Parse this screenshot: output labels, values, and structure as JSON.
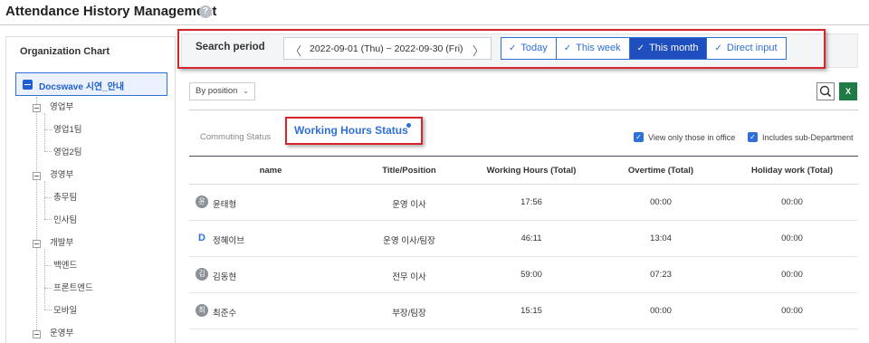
{
  "header": {
    "title": "Attendance History Management",
    "help_glyph": "?"
  },
  "org_chart": {
    "title": "Organization Chart",
    "root_label": "Docswave 시연_안내",
    "groups": [
      {
        "label": "영업부",
        "children": [
          "영업1팀",
          "영업2팀"
        ]
      },
      {
        "label": "경영부",
        "children": [
          "총무팀",
          "인사팀"
        ]
      },
      {
        "label": "개발부",
        "children": [
          "백엔드",
          "프론트엔드",
          "모바일"
        ]
      },
      {
        "label": "운영부",
        "children": []
      }
    ]
  },
  "search": {
    "label": "Search period",
    "prev_glyph": "〈",
    "next_glyph": "〉",
    "range": "2022-09-01 (Thu) ~ 2022-09-30 (Fri)",
    "options": [
      {
        "label": "Today",
        "active": false
      },
      {
        "label": "This week",
        "active": false
      },
      {
        "label": "This month",
        "active": true
      },
      {
        "label": "Direct input",
        "active": false
      }
    ]
  },
  "toolbar": {
    "position_select": "By position",
    "excel_glyph": "X"
  },
  "tabs": {
    "commuting": "Commuting Status",
    "working": "Working Hours Status"
  },
  "filters": {
    "view_in_office": "View only those in office",
    "include_sub": "Includes sub-Department"
  },
  "table": {
    "headers": [
      "name",
      "Title/Position",
      "Working Hours (Total)",
      "Overtime (Total)",
      "Holiday work (Total)"
    ],
    "rows": [
      {
        "avatar": "윤",
        "name": "윤태형",
        "title": "운영 이사",
        "working": "17:56",
        "overtime": "00:00",
        "holiday": "00:00"
      },
      {
        "avatar": "D",
        "name": "정혜이브",
        "title": "운영 이사/팀장",
        "working": "46:11",
        "overtime": "13:04",
        "holiday": "00:00"
      },
      {
        "avatar": "김",
        "name": "김동현",
        "title": "전무 이사",
        "working": "59:00",
        "overtime": "07:23",
        "holiday": "00:00"
      },
      {
        "avatar": "최",
        "name": "최준수",
        "title": "부장/팀장",
        "working": "15:15",
        "overtime": "00:00",
        "holiday": "00:00"
      }
    ]
  },
  "colors": {
    "accent": "#2f6fd8",
    "active_segment": "#1f4fbf",
    "highlight_border": "#d7262b",
    "excel": "#1f7a45"
  }
}
